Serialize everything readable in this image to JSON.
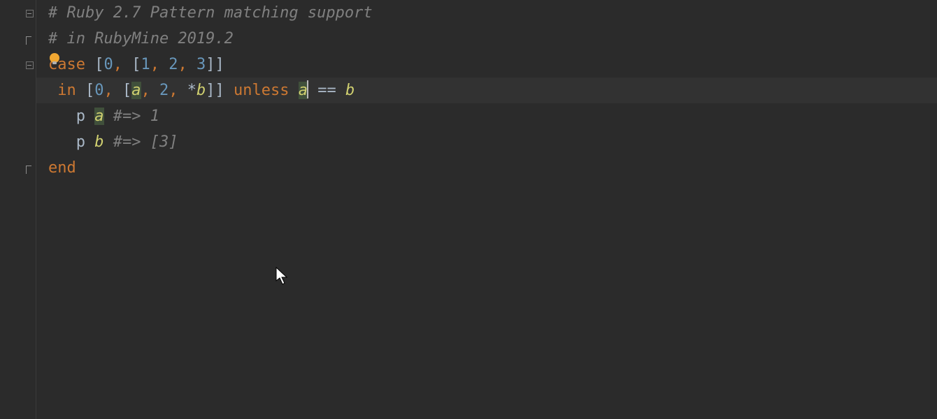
{
  "lines": {
    "l1": {
      "comment": "# Ruby 2.7 Pattern matching support"
    },
    "l2": {
      "comment": "# in RubyMine 2019.2"
    },
    "l3": {
      "kw_case": "case",
      "sp": " ",
      "lb1": "[",
      "n0": "0",
      "comma1": ",",
      "sp2": " ",
      "lb2": "[",
      "n1": "1",
      "comma2": ",",
      "sp3": " ",
      "n2": "2",
      "comma3": ",",
      "sp4": " ",
      "n3": "3",
      "rb2": "]",
      "rb1": "]"
    },
    "l4": {
      "indent": " ",
      "kw_in": "in",
      "sp1": " ",
      "lb1": "[",
      "n0": "0",
      "comma1": ",",
      "sp2": " ",
      "lb2": "[",
      "va": "a",
      "comma2": ",",
      "sp3": " ",
      "n2": "2",
      "comma3": ",",
      "sp4": " ",
      "star": "*",
      "vb": "b",
      "rb2": "]",
      "rb1": "]",
      "sp5": " ",
      "kw_unless": "unless",
      "sp6": " ",
      "va2": "a",
      "sp7": " ",
      "eq": "==",
      "sp8": " ",
      "vb2": "b"
    },
    "l5": {
      "indent": "   ",
      "p": "p",
      "sp": " ",
      "va": "a",
      "sp2": " ",
      "comment": "#=> 1"
    },
    "l6": {
      "indent": "   ",
      "p": "p",
      "sp": " ",
      "vb": "b",
      "sp2": " ",
      "comment": "#=> [3]"
    },
    "l7": {
      "kw_end": "end"
    }
  }
}
